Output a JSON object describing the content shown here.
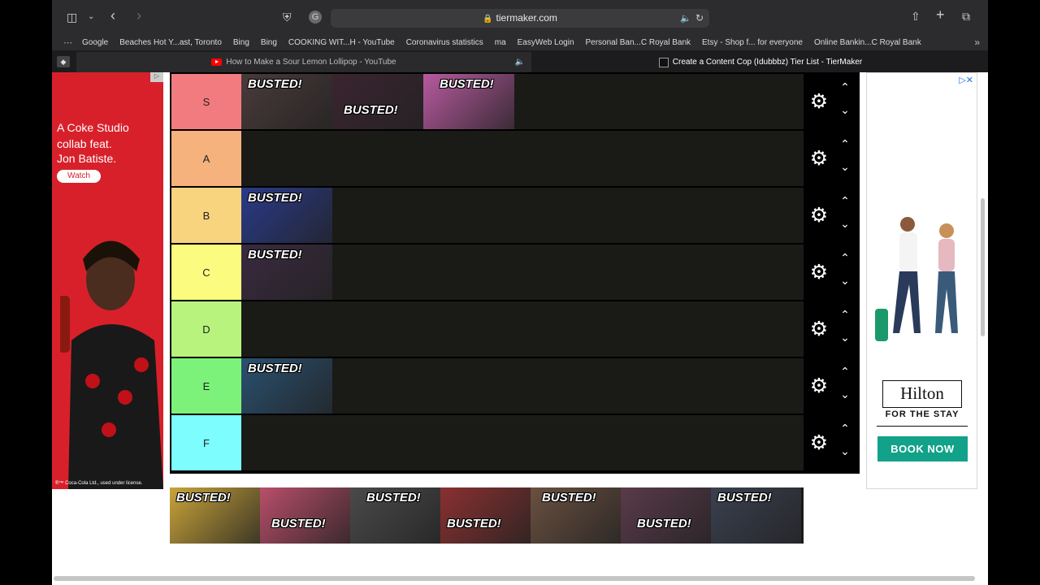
{
  "browser": {
    "url": "tiermaker.com",
    "bookmarks": [
      "Google",
      "Beaches Hot Y...ast, Toronto",
      "Bing",
      "Bing",
      "COOKING WIT...H - YouTube",
      "Coronavirus statistics",
      "ma",
      "EasyWeb Login",
      "Personal Ban...C Royal Bank",
      "Etsy - Shop f... for everyone",
      "Online Bankin...C Royal Bank"
    ],
    "tabs": [
      {
        "title": "How to Make a Sour Lemon Lollipop - YouTube"
      },
      {
        "title": "Create a Content Cop (Idubbbz) Tier List - TierMaker"
      }
    ]
  },
  "ad_left": {
    "lines": [
      "A Coke Studio",
      "collab feat.",
      "Jon Batiste."
    ],
    "button": "Watch",
    "fineprint": "®™ Coca-Cola Ltd., used under license."
  },
  "ad_right": {
    "brand": "Hilton",
    "tagline": "FOR THE STAY",
    "button": "BOOK NOW"
  },
  "tiers": [
    {
      "label": "S",
      "color": "#f27b7f",
      "thumbs": [
        {
          "text": "BUSTED!",
          "bg": "#4a3a3a"
        },
        {
          "text": "BUSTED!",
          "bg": "#3a2430"
        },
        {
          "text": "BUSTED!",
          "bg": "#b85aa0"
        }
      ]
    },
    {
      "label": "A",
      "color": "#f5b27c",
      "thumbs": []
    },
    {
      "label": "B",
      "color": "#f8d47f",
      "thumbs": [
        {
          "text": "BUSTED!",
          "bg": "#2a3a8a"
        }
      ]
    },
    {
      "label": "C",
      "color": "#fbfb7f",
      "thumbs": [
        {
          "text": "BUSTED!",
          "bg": "#3a2a40"
        }
      ]
    },
    {
      "label": "D",
      "color": "#b8f37d",
      "thumbs": []
    },
    {
      "label": "E",
      "color": "#7df27a",
      "thumbs": [
        {
          "text": "BUSTED!",
          "bg": "#2a5070"
        }
      ]
    },
    {
      "label": "F",
      "color": "#7dfdfd",
      "thumbs": []
    }
  ],
  "pool": [
    {
      "text": "BUSTED!",
      "bg": "#c9a43a"
    },
    {
      "text": "BUSTED!",
      "bg": "#b94e6a"
    },
    {
      "text": "BUSTED!",
      "bg": "#4a4a4a"
    },
    {
      "text": "BUSTED!",
      "bg": "#8a3030"
    },
    {
      "text": "BUSTED!",
      "bg": "#6a5040"
    },
    {
      "text": "BUSTED!",
      "bg": "#5a3a4a"
    },
    {
      "text": "BUSTED!",
      "bg": "#3a4050"
    }
  ]
}
